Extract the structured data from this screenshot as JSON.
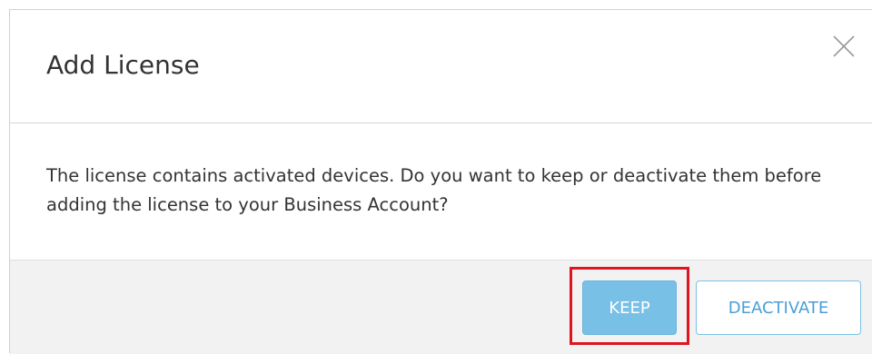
{
  "dialog": {
    "title": "Add License",
    "close_icon": "close-icon",
    "message": "The license contains activated devices. Do you want to keep or deactivate them before adding the license to your Business Account?",
    "buttons": {
      "keep_label": "KEEP",
      "deactivate_label": "DEACTIVATE"
    }
  },
  "colors": {
    "primary_button_bg": "#79c0e6",
    "secondary_button_text": "#4a9fd6",
    "highlight_border": "#e0141f",
    "footer_bg": "#f2f2f2"
  }
}
